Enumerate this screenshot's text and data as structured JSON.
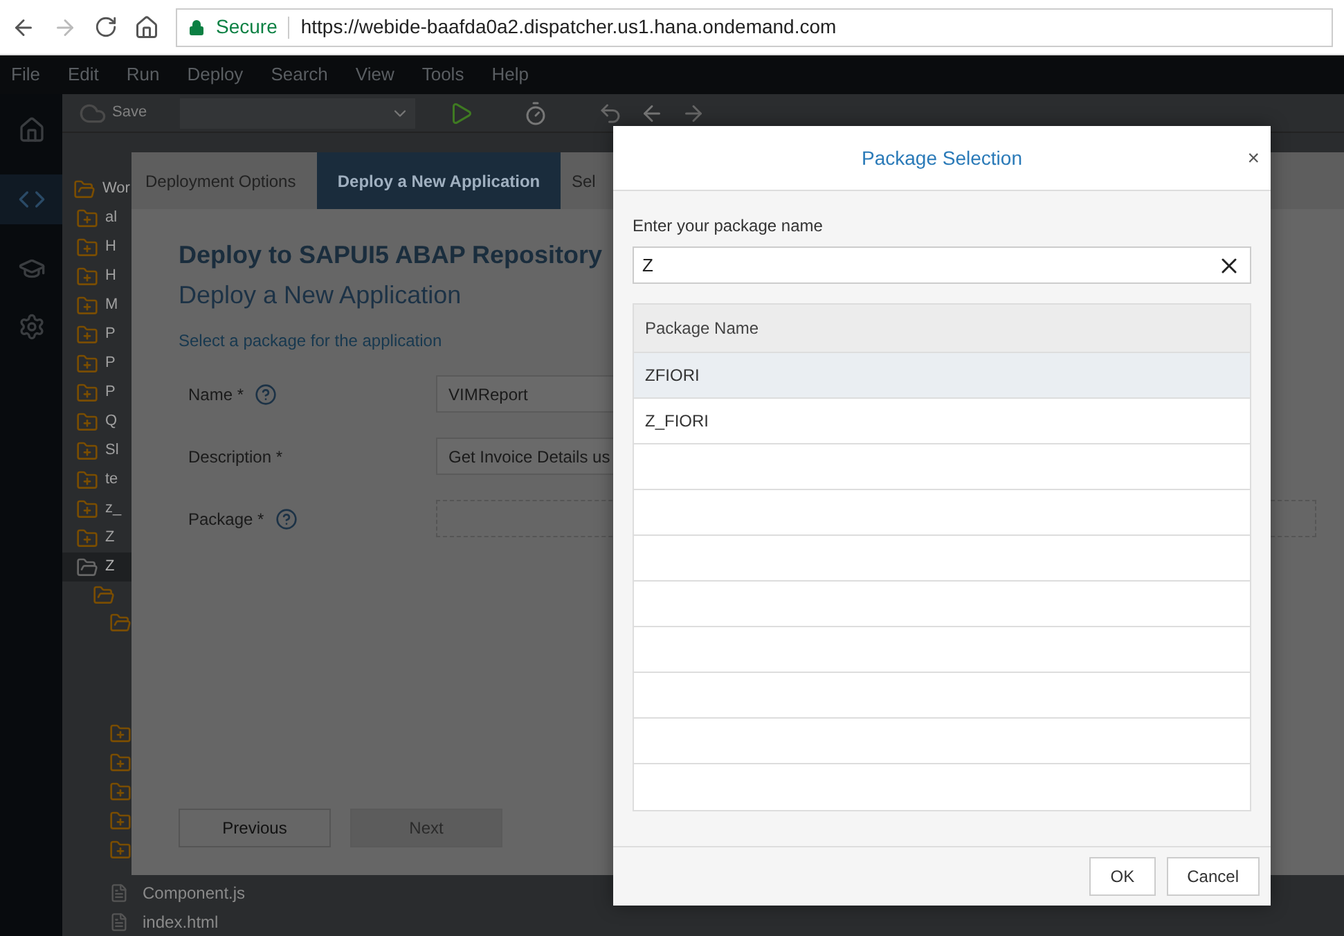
{
  "browser": {
    "secure_label": "Secure",
    "url": "https://webide-baafda0a2.dispatcher.us1.hana.ondemand.com"
  },
  "menu": [
    "File",
    "Edit",
    "Run",
    "Deploy",
    "Search",
    "View",
    "Tools",
    "Help"
  ],
  "toolbar": {
    "save": "Save"
  },
  "tree": {
    "root": "Wor",
    "items": [
      {
        "label": "al"
      },
      {
        "label": "H"
      },
      {
        "label": "H"
      },
      {
        "label": "M"
      },
      {
        "label": "P"
      },
      {
        "label": "P"
      },
      {
        "label": "P"
      },
      {
        "label": "Q"
      },
      {
        "label": "Sl"
      },
      {
        "label": "te"
      },
      {
        "label": "z_"
      },
      {
        "label": "Z"
      }
    ],
    "open_item": "Z",
    "files": [
      "Component.js",
      "index.html"
    ]
  },
  "wizard": {
    "steps": [
      {
        "label": "Deployment Options",
        "selected": false
      },
      {
        "label": "Deploy a New Application",
        "selected": true
      },
      {
        "label": "Sel",
        "selected": false
      }
    ],
    "title": "Deploy to SAPUI5 ABAP Repository",
    "subtitle": "Deploy a New Application",
    "hint": "Select a package for the application",
    "fields": [
      {
        "label": "Name *",
        "help": true,
        "value": "VIMReport"
      },
      {
        "label": "Description *",
        "help": false,
        "value": "Get Invoice Details us"
      },
      {
        "label": "Package *",
        "help": true
      }
    ],
    "buttons": [
      {
        "label": "Previous",
        "disabled": false
      },
      {
        "label": "Next",
        "disabled": true
      }
    ]
  },
  "dialog": {
    "title": "Package Selection",
    "close": "×",
    "field_label": "Enter your package name",
    "field_value": "Z",
    "table": {
      "columns": [
        "Package Name"
      ],
      "rows": [
        {
          "name": "ZFIORI",
          "selected": true
        },
        {
          "name": "Z_FIORI",
          "selected": false
        }
      ]
    },
    "buttons": [
      "OK",
      "Cancel"
    ]
  }
}
